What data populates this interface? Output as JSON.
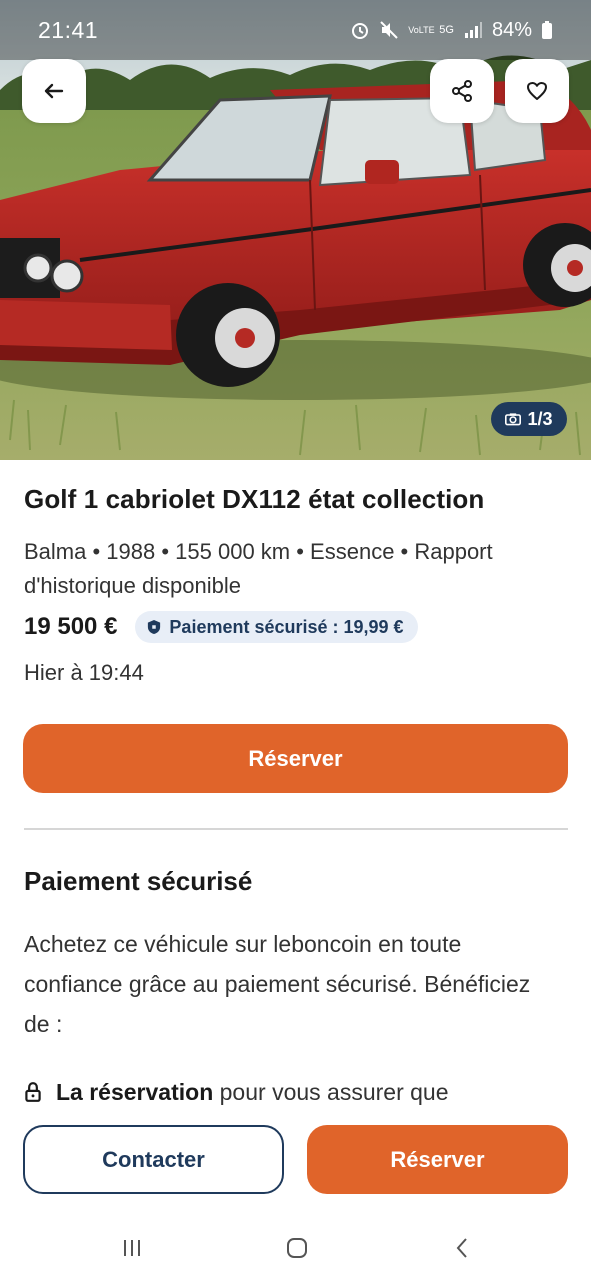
{
  "status_bar": {
    "time": "21:41",
    "battery": "84%",
    "network": "5G",
    "volte": "VoLTE"
  },
  "hero": {
    "image_counter": "1/3",
    "icons": [
      "back-arrow-icon",
      "share-icon",
      "heart-icon",
      "camera-icon"
    ]
  },
  "listing": {
    "title": "Golf 1 cabriolet DX112 état collection",
    "meta": "Balma • 1988 • 155 000 km • Essence • Rapport d'historique disponible",
    "price": "19 500 €",
    "secure_badge": "Paiement sécurisé : 19,99 €",
    "posted": "Hier à 19:44",
    "reserve_label": "Réserver"
  },
  "secure_section": {
    "title": "Paiement sécurisé",
    "text": "Achetez ce véhicule sur leboncoin en toute confiance grâce au paiement sécurisé. Bénéficiez de :",
    "feature_bold": "La réservation",
    "feature_rest": " pour vous assurer que"
  },
  "bottom_bar": {
    "contact_label": "Contacter",
    "reserve_label": "Réserver"
  },
  "colors": {
    "accent": "#e0642a",
    "navy": "#1f3a5c",
    "badge_bg": "#e8eef7"
  }
}
